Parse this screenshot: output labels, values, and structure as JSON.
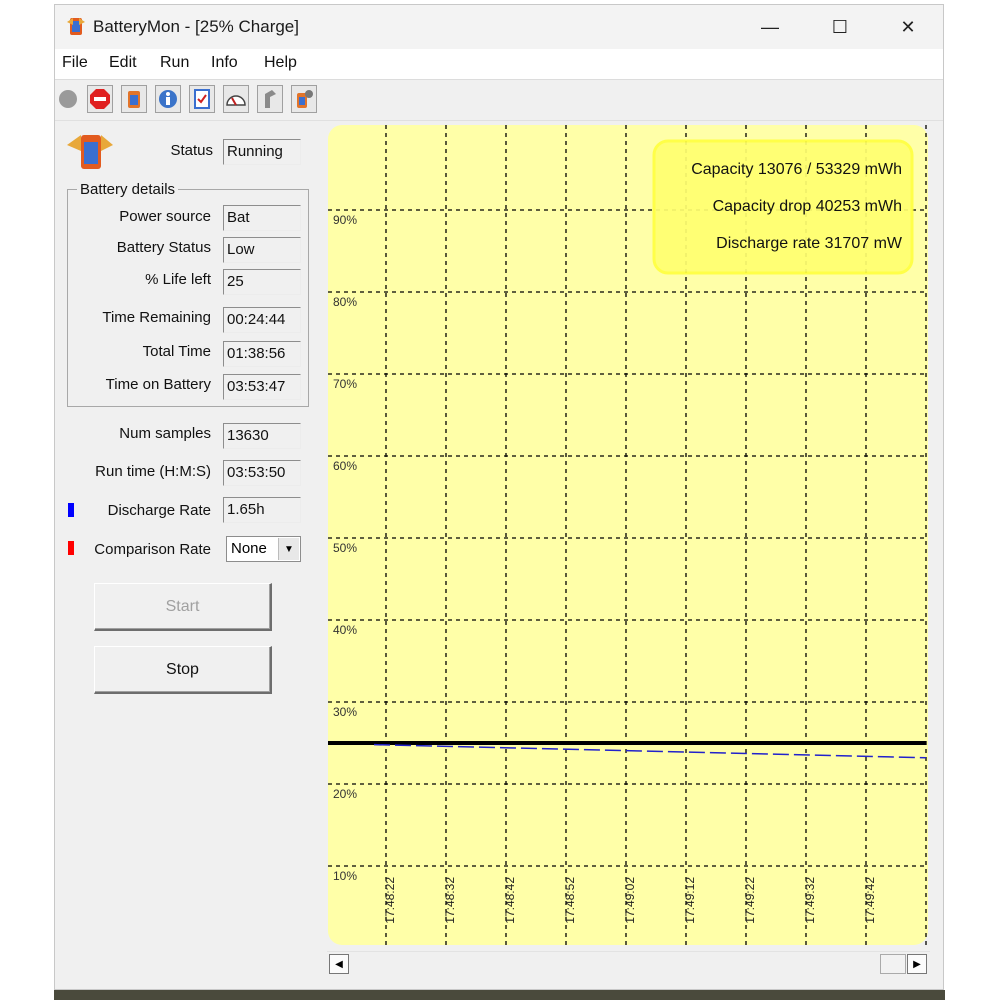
{
  "window": {
    "title": "BatteryMon - [25% Charge]",
    "controls": {
      "minimize": "—",
      "maximize": "☐",
      "close": "✕"
    }
  },
  "menu": [
    "File",
    "Edit",
    "Run",
    "Info",
    "Help"
  ],
  "toolbar": {
    "icons": [
      "record-icon",
      "stop-icon",
      "battery-icon",
      "battery-info-icon",
      "checklist-icon",
      "gauge-icon",
      "pointer-icon",
      "settings-battery-icon"
    ]
  },
  "status": {
    "label": "Status",
    "value": "Running"
  },
  "battery_details": {
    "title": "Battery details",
    "rows": [
      {
        "label": "Power source",
        "value": "Bat"
      },
      {
        "label": "Battery Status",
        "value": "Low"
      },
      {
        "label": "% Life left",
        "value": "25"
      },
      {
        "label": "Time Remaining",
        "value": "00:24:44"
      },
      {
        "label": "Total Time",
        "value": "01:38:56"
      },
      {
        "label": "Time on Battery",
        "value": "03:53:47"
      }
    ]
  },
  "samples": {
    "label": "Num samples",
    "value": "13630"
  },
  "runtime": {
    "label": "Run time (H:M:S)",
    "value": "03:53:50"
  },
  "discharge_rate": {
    "label": "Discharge Rate",
    "value": "1.65h",
    "color": "#0000ff"
  },
  "comparison_rate": {
    "label": "Comparison Rate",
    "value": "None",
    "color": "#ff0000"
  },
  "buttons": {
    "start": "Start",
    "stop": "Stop"
  },
  "chart_data": {
    "type": "line",
    "y_ticks": [
      "10%",
      "20%",
      "30%",
      "40%",
      "50%",
      "60%",
      "70%",
      "80%",
      "90%"
    ],
    "x_ticks": [
      "17:48:22",
      "17:48:32",
      "17:48:42",
      "17:48:52",
      "17:49:02",
      "17:49:12",
      "17:49:22",
      "17:49:32",
      "17:49:42"
    ],
    "ylim": [
      0,
      100
    ],
    "grid": true,
    "background": "#ffffa8",
    "info": [
      "Capacity 13076 / 53329 mWh",
      "Capacity drop 40253 mWh",
      "Discharge rate 31707 mW"
    ],
    "series": [
      {
        "style": "solid",
        "color": "#000000",
        "x": [
          0,
          15
        ],
        "values": [
          25,
          25
        ]
      },
      {
        "style": "dashed",
        "color": "#2222cc",
        "x": [
          1.2,
          15
        ],
        "values": [
          24.8,
          23.2
        ]
      }
    ]
  }
}
